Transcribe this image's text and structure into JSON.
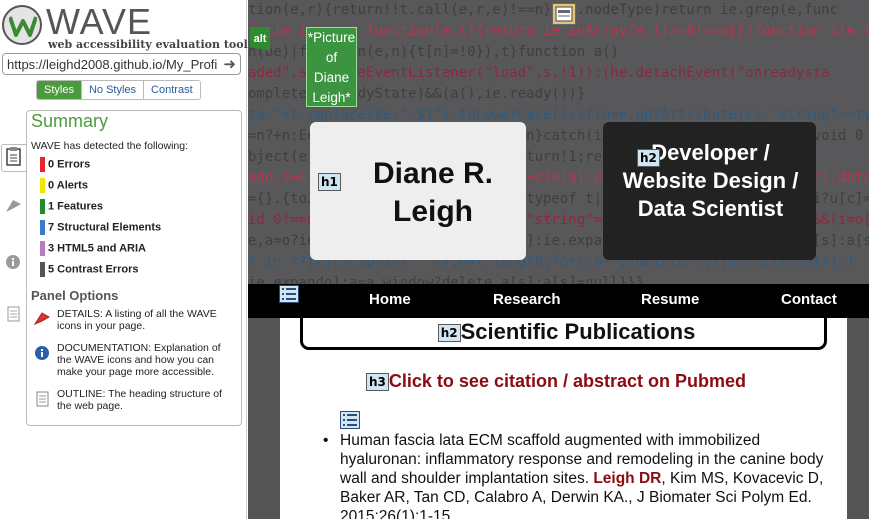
{
  "wave": {
    "logo_word": "WAVE",
    "tagline": "web accessibility evaluation tool",
    "url": "https://leighd2008.github.io/My_Profi",
    "view_tabs": [
      "Styles",
      "No Styles",
      "Contrast"
    ],
    "summary": {
      "title": "Summary",
      "intro": "WAVE has detected the following:",
      "stats": [
        {
          "label": "0 Errors",
          "color": "#e8272c"
        },
        {
          "label": "0 Alerts",
          "color": "#f2e600"
        },
        {
          "label": "1 Features",
          "color": "#1f8a2f"
        },
        {
          "label": "7 Structural Elements",
          "color": "#3a7cc9"
        },
        {
          "label": "3 HTML5 and ARIA",
          "color": "#b77bc4"
        },
        {
          "label": "5 Contrast Errors",
          "color": "#555555"
        }
      ]
    },
    "panel_options": {
      "title": "Panel Options",
      "items": [
        {
          "icon": "flag-icon",
          "text": "DETAILS: A listing of all the WAVE icons in your page."
        },
        {
          "icon": "info-icon",
          "text": "DOCUMENTATION: Explanation of the WAVE icons and how you can make your page more accessible."
        },
        {
          "icon": "document-icon",
          "text": "OUTLINE: The heading structure of the web page."
        }
      ]
    }
  },
  "page": {
    "code_lines": [
      "tion(e,r){return!!t.call(e,r,e)!==n}):r.nodeType)return ie.grep(e,func",
      "ie.ie.ie.gent.function(e,t){return ie.inArray(e,t)>=0!==n}})function i(e,t)",
      "n(be)|function(e,n){t[n]=!0}),t}function a()",
      "aded\",s.removeEventListener(\"load\",s,!1)):(he.detachEvent(\"onreadysta",
      "omplete\"||readyState)&&(a(),ie.ready())}",
      "ta-\"+t.replace(ke,\"-$1\").toLowerCase();if(n=e.getAttribute(r),\"string\"==typ",
      "=n?+n:Ee.test(n)?ie.parseJSON(n):n}catch(i){}ie.data(e,t,n)}else n=void 0",
      "bject(e)||void 0;if(e.nodeType)return!1;return",
      "ndo,s=e.nodeType,u=s?ie.cache:e,c=s?e[a]:e[a]&&a;if(c&&u[c]&&(i||u[c].data",
      "={}.{toJSON:ie.noop});(\"object\"==typeof t||\"function\"==typeof t)&&(i?u[c]=id",
      "id 0!==n&&(l[ie.camelCase(t)]=n),\"string\"==typeof t?(r=l[t],null==r&&(i=o[E",
      "e,a=o?ie.cache:e,s=o?e[ie.expando]:ie.expando;if(a[s]){if(t&&(r=i?a[s]:a[s",
      "t in r?[t]:t.split(\" \")),n=t.length;for(;n--;)delete r[t[n]];if(n?u(r):!",
      "ie.expando]:a=a.window?delete a[s]:a[s]=null}}}"
    ],
    "alt_label": "alt",
    "picture_text": "*Picture of Diane Leigh*",
    "h1_tag": "h1",
    "h1_text": "Diane R. Leigh",
    "h2_tag": "h2",
    "h2_dev_text": "Developer / Website Design / Data Scientist",
    "nav": [
      "Home",
      "Research",
      "Resume",
      "Contact"
    ],
    "pub_heading_tag": "h2",
    "pub_heading": "Scientific Publications",
    "h3_tag": "h3",
    "click_text": "Click to see citation / abstract on Pubmed",
    "pub_before": "Human fascia lata ECM scaffold augmented with immobilized hyaluronan: inflammatory response and remodeling in the canine body wall and shoulder implantation sites. ",
    "pub_author": "Leigh DR",
    "pub_after": ", Kim MS, Kovacevic D, Baker AR, Tan CD, Calabro A, Derwin KA., J Biomater Sci Polym Ed. 2015;26(1):1-15."
  }
}
